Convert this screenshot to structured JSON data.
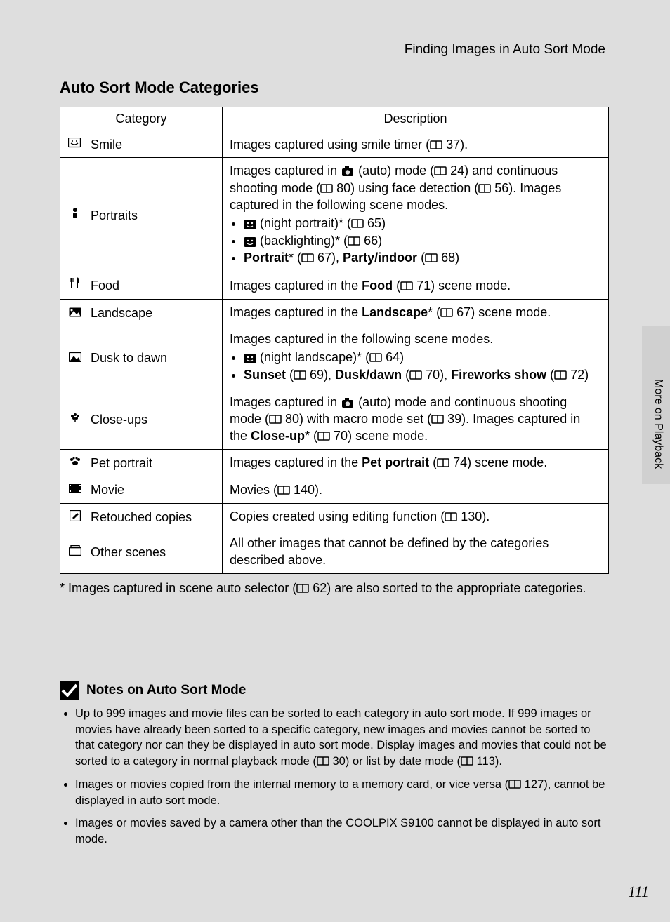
{
  "chapter": "Finding Images in Auto Sort Mode",
  "section_title": "Auto Sort Mode Categories",
  "table": {
    "head": {
      "col1": "Category",
      "col2": "Description"
    },
    "rows": {
      "smile": {
        "label": "Smile"
      },
      "portraits": {
        "label": "Portraits"
      },
      "food": {
        "label": "Food"
      },
      "landscape": {
        "label": "Landscape"
      },
      "dusk": {
        "label": "Dusk to dawn"
      },
      "closeups": {
        "label": "Close-ups"
      },
      "pet": {
        "label": "Pet portrait"
      },
      "movie": {
        "label": "Movie"
      },
      "retouch": {
        "label": "Retouched copies"
      },
      "other": {
        "label": "Other scenes"
      }
    },
    "desc": {
      "smile_1": "Images captured using smile timer (",
      "smile_2": " 37).",
      "portraits_1": "Images captured in ",
      "portraits_2": " (auto) mode (",
      "portraits_3": " 24) and continuous shooting mode (",
      "portraits_4": " 80) using face detection (",
      "portraits_5": " 56). Images captured in the following scene modes.",
      "portraits_b1a": " (night portrait)* (",
      "portraits_b1b": " 65)",
      "portraits_b2a": " (backlighting)* (",
      "portraits_b2b": " 66)",
      "portraits_b3a": "Portrait",
      "portraits_b3b": "* (",
      "portraits_b3c": " 67), ",
      "portraits_b3d": "Party/indoor",
      "portraits_b3e": " (",
      "portraits_b3f": " 68)",
      "food_1": "Images captured in the ",
      "food_2": "Food",
      "food_3": " (",
      "food_4": " 71) scene mode.",
      "landscape_1": "Images captured in the ",
      "landscape_2": "Landscape",
      "landscape_3": "* (",
      "landscape_4": " 67) scene mode.",
      "dusk_1": "Images captured in the following scene modes.",
      "dusk_b1a": " (night landscape)* (",
      "dusk_b1b": " 64)",
      "dusk_b2a": "Sunset",
      "dusk_b2b": " (",
      "dusk_b2c": " 69), ",
      "dusk_b2d": "Dusk/dawn",
      "dusk_b2e": " (",
      "dusk_b2f": " 70), ",
      "dusk_b2g": "Fireworks show",
      "dusk_b2h": " (",
      "dusk_b2i": " 72)",
      "closeups_1": "Images captured in ",
      "closeups_2": " (auto) mode and continuous shooting mode (",
      "closeups_3": " 80) with macro mode set (",
      "closeups_4": " 39). Images captured in the ",
      "closeups_5": "Close-up",
      "closeups_6": "* (",
      "closeups_7": " 70) scene mode.",
      "pet_1": "Images captured in the ",
      "pet_2": "Pet portrait",
      "pet_3": " (",
      "pet_4": " 74) scene mode.",
      "movie_1": "Movies (",
      "movie_2": " 140).",
      "retouch_1": "Copies created using editing function (",
      "retouch_2": " 130).",
      "other_1": "All other images that cannot be defined by the categories described above."
    }
  },
  "footnote_1": "*  Images captured in scene auto selector (",
  "footnote_2": " 62) are also sorted to the appropriate categories.",
  "notes": {
    "title": "Notes on Auto Sort Mode",
    "n1a": "Up to 999 images and movie files can be sorted to each category in auto sort mode. If 999 images or movies have already been sorted to a specific category, new images and movies cannot be sorted to that category nor can they be displayed in auto sort mode. Display images and movies that could not be sorted to a category in normal playback mode (",
    "n1b": " 30) or list by date mode (",
    "n1c": " 113).",
    "n2a": "Images or movies copied from the internal memory to a memory card, or vice versa (",
    "n2b": " 127), cannot be displayed in auto sort mode.",
    "n3": "Images or movies saved by a camera other than the COOLPIX S9100 cannot be displayed in auto sort mode."
  },
  "side_label": "More on Playback",
  "page_number": "111"
}
